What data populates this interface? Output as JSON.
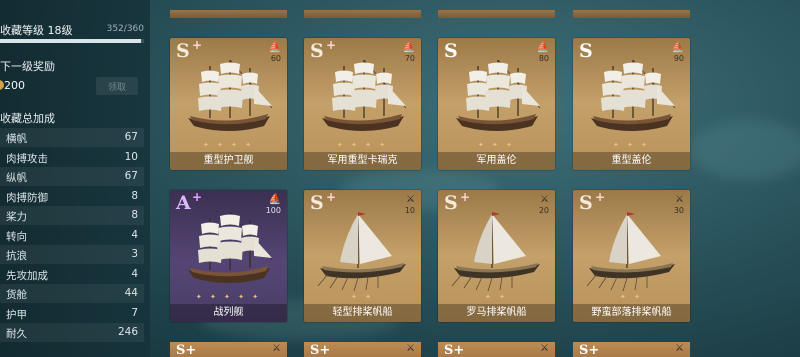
{
  "left_panel": {
    "collection_level": "收藏等级 18级",
    "progress_text": "352/360",
    "progress_fraction": 0.978,
    "next_reward_label": "下一级奖励",
    "reward_value": "200",
    "claim_button": "领取",
    "total_bonus_label": "收藏总加成",
    "stats": [
      {
        "name": "横帆",
        "value": "67"
      },
      {
        "name": "肉搏攻击",
        "value": "10"
      },
      {
        "name": "纵帆",
        "value": "67"
      },
      {
        "name": "肉搏防御",
        "value": "8"
      },
      {
        "name": "桨力",
        "value": "8"
      },
      {
        "name": "转向",
        "value": "4"
      },
      {
        "name": "抗浪",
        "value": "3"
      },
      {
        "name": "先攻加成",
        "value": "4"
      },
      {
        "name": "货舱",
        "value": "44"
      },
      {
        "name": "护甲",
        "value": "7"
      },
      {
        "name": "耐久",
        "value": "246"
      }
    ]
  },
  "cards": [
    {
      "name": "重型护卫舰",
      "grade": "S",
      "plus": "+",
      "power": "60",
      "type_icon": "sail-icon",
      "stars": "✦ ✦ ✦ ✦",
      "sail_type": "square"
    },
    {
      "name": "军用重型卡瑞克",
      "grade": "S",
      "plus": "+",
      "power": "70",
      "type_icon": "sail-icon",
      "stars": "✦ ✦ ✦ ✦",
      "sail_type": "square"
    },
    {
      "name": "军用盖伦",
      "grade": "S",
      "plus": "",
      "power": "80",
      "type_icon": "sail-icon",
      "stars": "✦ ✦ ✦",
      "sail_type": "square"
    },
    {
      "name": "重型盖伦",
      "grade": "S",
      "plus": "",
      "power": "90",
      "type_icon": "sail-icon",
      "stars": "✦ ✦ ✦",
      "sail_type": "square"
    },
    {
      "name": "战列舰",
      "grade": "A",
      "plus": "+",
      "power": "100",
      "type_icon": "sail-icon",
      "stars": "✦ ✦ ✦ ✦ ✦",
      "sail_type": "square"
    },
    {
      "name": "轻型排桨帆船",
      "grade": "S",
      "plus": "+",
      "power": "10",
      "type_icon": "swords-icon",
      "stars": "✦ ✦",
      "sail_type": "lateen"
    },
    {
      "name": "罗马排桨帆船",
      "grade": "S",
      "plus": "+",
      "power": "20",
      "type_icon": "swords-icon",
      "stars": "✦ ✦",
      "sail_type": "lateen"
    },
    {
      "name": "野蛮部落排桨帆船",
      "grade": "S",
      "plus": "+",
      "power": "30",
      "type_icon": "swords-icon",
      "stars": "✦ ✦",
      "sail_type": "lateen"
    }
  ],
  "bottom_row": [
    {
      "grade": "S",
      "plus": "+",
      "type_icon": "swords-icon"
    },
    {
      "grade": "S",
      "plus": "+",
      "type_icon": "swords-icon"
    },
    {
      "grade": "S",
      "plus": "+",
      "type_icon": "swords-icon"
    },
    {
      "grade": "S",
      "plus": "+",
      "type_icon": "swords-icon"
    }
  ],
  "colors": {
    "card_s": "#c4935c",
    "card_a": "#554575",
    "sea": "#2c5761"
  }
}
